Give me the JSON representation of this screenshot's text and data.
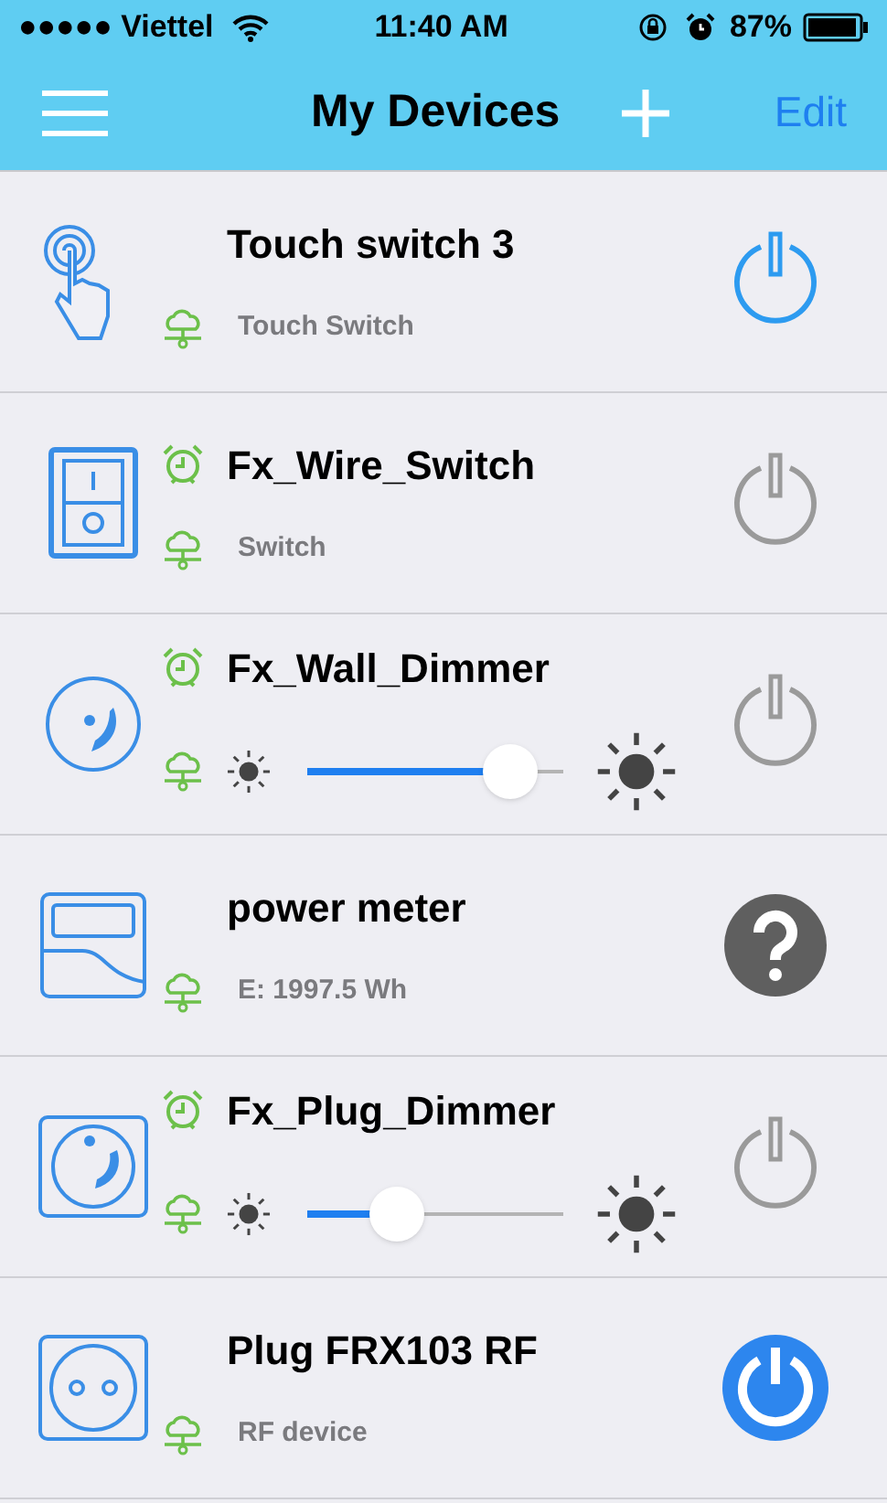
{
  "status_bar": {
    "carrier": "●●●●● Viettel",
    "time": "11:40 AM",
    "battery_percent": "87%"
  },
  "nav": {
    "title": "My Devices",
    "edit": "Edit"
  },
  "devices": [
    {
      "kind": "touch",
      "name": "Touch switch 3",
      "timer": false,
      "subtitle": "Touch Switch",
      "power": {
        "kind": "ring",
        "on": true
      }
    },
    {
      "kind": "switch",
      "name": "Fx_Wire_Switch",
      "timer": true,
      "subtitle": "Switch",
      "power": {
        "kind": "ring",
        "on": false
      }
    },
    {
      "kind": "dimmer",
      "name": "Fx_Wall_Dimmer",
      "timer": true,
      "level": 0.79,
      "power": {
        "kind": "ring",
        "on": false
      }
    },
    {
      "kind": "meter",
      "name": "power meter",
      "timer": false,
      "subtitle": "E: 1997.5 Wh",
      "power": {
        "kind": "help"
      }
    },
    {
      "kind": "plug_dimmer",
      "name": "Fx_Plug_Dimmer",
      "timer": true,
      "level": 0.35,
      "power": {
        "kind": "ring",
        "on": false
      }
    },
    {
      "kind": "plug",
      "name": "Plug FRX103 RF",
      "timer": false,
      "subtitle": "RF device",
      "power": {
        "kind": "filled",
        "on": true
      }
    }
  ]
}
